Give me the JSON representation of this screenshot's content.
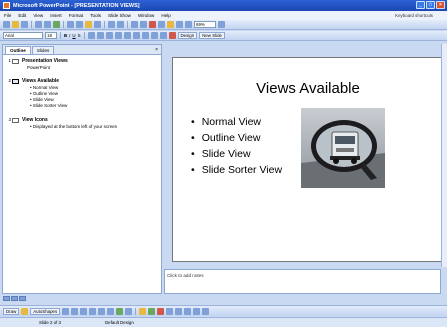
{
  "window": {
    "title": "Microsoft PowerPoint - [PRESENTATION VIEWS]"
  },
  "menu": [
    "File",
    "Edit",
    "View",
    "Insert",
    "Format",
    "Tools",
    "Slide Show",
    "Window",
    "Help"
  ],
  "help_placeholder": "Keyboard shortcuts",
  "formatting": {
    "font": "Arial",
    "size": "18",
    "zoom": "69%",
    "design_label": "Design",
    "new_slide_label": "New Slide"
  },
  "left_pane": {
    "tabs": [
      "Outline",
      "Slides"
    ],
    "slides": [
      {
        "num": "1",
        "title": "Presentation Views",
        "subtitle": "PowerPoint",
        "bullets": []
      },
      {
        "num": "2",
        "title": "Views Available",
        "subtitle": "",
        "bullets": [
          "Normal View",
          "Outline View",
          "Slide View",
          "Slide Sorter View"
        ]
      },
      {
        "num": "3",
        "title": "View Icons",
        "subtitle": "",
        "bullets": [
          "Displayed at the bottom left of your screen"
        ]
      }
    ]
  },
  "slide": {
    "title": "Views Available",
    "bullets": [
      "Normal View",
      "Outline View",
      "Slide View",
      "Slide Sorter View"
    ],
    "image_icon": "truck-in-side-mirror-photo"
  },
  "notes": {
    "placeholder": "Click to add notes"
  },
  "drawing": {
    "draw_label": "Draw",
    "autoshapes_label": "AutoShapes"
  },
  "status": {
    "slide_info": "Slide 2 of 3",
    "design": "Default Design"
  },
  "colors": {
    "titlebar": "#2c62d3",
    "workspace": "#c9d9f1"
  }
}
